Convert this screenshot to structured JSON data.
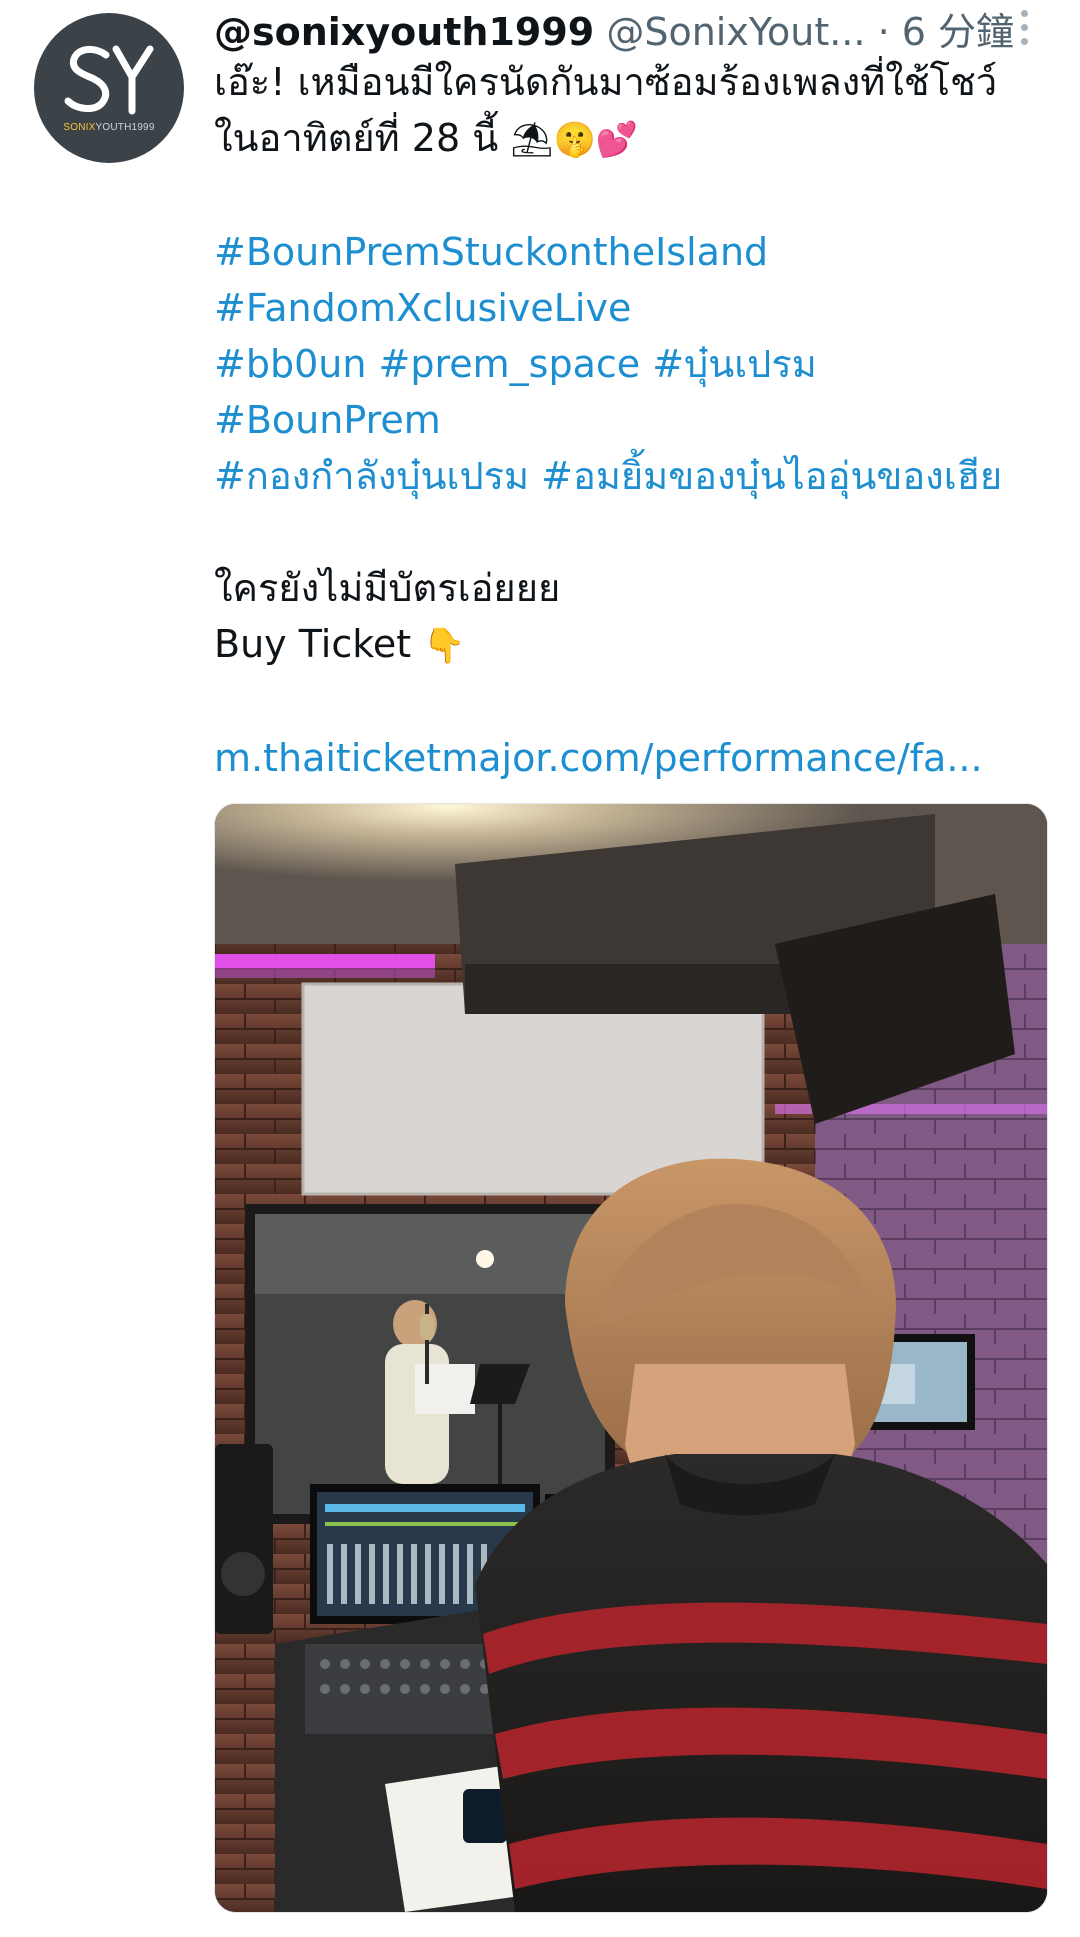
{
  "tweet": {
    "avatar": {
      "monogram": "SY",
      "caption_brand": "SONIX",
      "caption_rest": "YOUTH1999"
    },
    "display_name": "@sonixyouth1999",
    "handle": "@SonixYout...",
    "separator": "·",
    "time": "6 分鐘",
    "text_lines": [
      "เอ๊ะ! เหมือนมีใครนัดกันมาซ้อมร้องเพลงที่ใช้โชว์",
      "ในอาทิตย์ที่ 28 นี้"
    ],
    "emojis_line2": [
      "⛱",
      "🤫",
      "💕"
    ],
    "hashtags": {
      "row1": [
        "#BounPremStuckontheIsland"
      ],
      "row2": [
        "#FandomXclusiveLive"
      ],
      "row3": [
        "#bb0un",
        "#prem_space",
        "#บุ๋นเปรม"
      ],
      "row4": [
        "#BounPrem"
      ],
      "row5": [
        "#กองกำลังบุ๋นเปรม",
        "#อมยิ้มของบุ๋นไออุ่นของเฮีย"
      ]
    },
    "ticket_question": "ใครยังไม่มีบัตรเอ่ยยย",
    "buy_ticket": "Buy Ticket",
    "buy_ticket_emoji": "👇",
    "link": "m.thaiticketmajor.com/performance/fa..."
  },
  "colors": {
    "link": "#1d8fd1",
    "text": "#0f1419",
    "muted": "#536471",
    "avatar_bg": "#3b4248"
  },
  "icons": {
    "more": "more-vertical-icon"
  }
}
